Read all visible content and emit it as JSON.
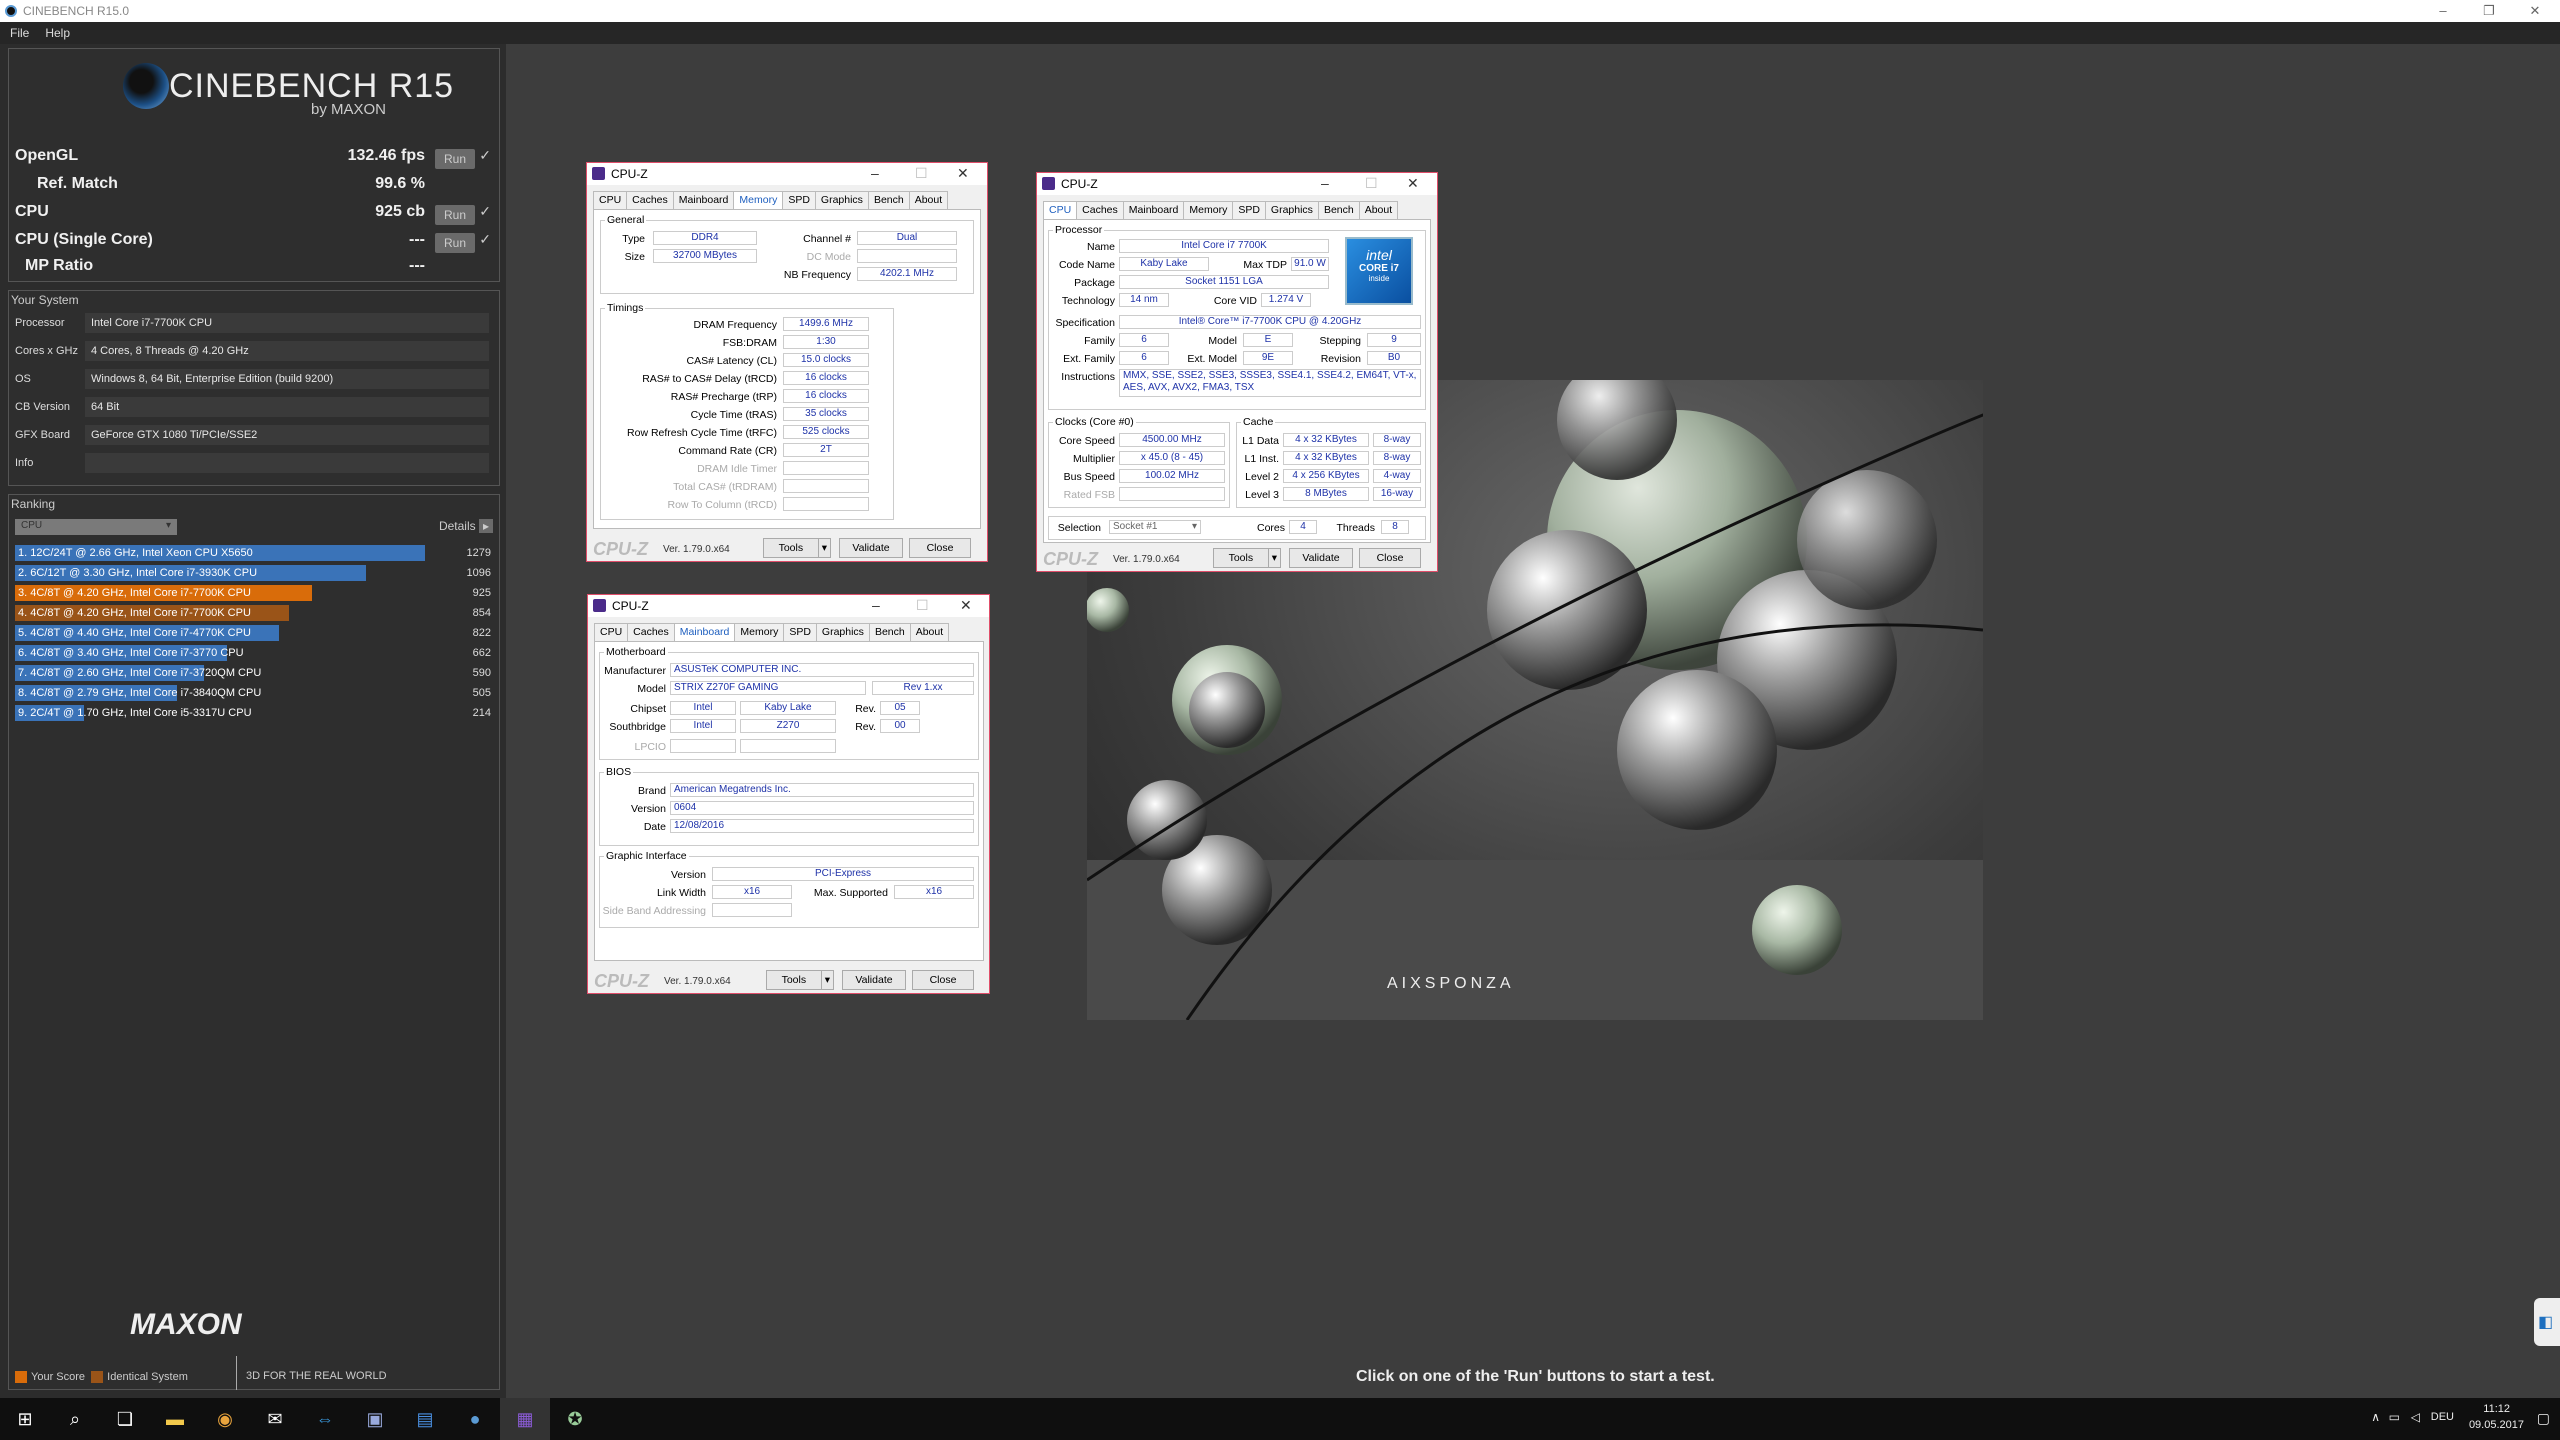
{
  "window": {
    "title": "CINEBENCH R15.0",
    "menu": [
      "File",
      "Help"
    ]
  },
  "logo": {
    "title": "CINEBENCH R15",
    "subtitle": "by MAXON"
  },
  "results": {
    "opengl": {
      "label": "OpenGL",
      "value": "132.46 fps",
      "run": "Run"
    },
    "refmatch": {
      "label": "Ref. Match",
      "value": "99.6 %"
    },
    "cpu": {
      "label": "CPU",
      "value": "925 cb",
      "run": "Run"
    },
    "cpu_single": {
      "label": "CPU (Single Core)",
      "value": "---",
      "run": "Run"
    },
    "mp_ratio": {
      "label": "MP Ratio",
      "value": "---"
    }
  },
  "system": {
    "title": "Your System",
    "rows": [
      {
        "k": "Processor",
        "v": "Intel Core i7-7700K CPU"
      },
      {
        "k": "Cores x GHz",
        "v": "4 Cores, 8 Threads @ 4.20 GHz"
      },
      {
        "k": "OS",
        "v": "Windows 8, 64 Bit, Enterprise Edition (build 9200)"
      },
      {
        "k": "CB Version",
        "v": "64 Bit"
      },
      {
        "k": "GFX Board",
        "v": "GeForce GTX 1080 Ti/PCIe/SSE2"
      },
      {
        "k": "Info",
        "v": ""
      }
    ]
  },
  "ranking": {
    "title": "Ranking",
    "dropdown": "CPU",
    "details": "Details",
    "max": 1279,
    "rows": [
      {
        "label": "1. 12C/24T @ 2.66 GHz, Intel Xeon CPU X5650",
        "score": 1279,
        "color": "#3a73b8"
      },
      {
        "label": "2. 6C/12T @ 3.30 GHz,  Intel Core i7-3930K CPU",
        "score": 1096,
        "color": "#3a73b8"
      },
      {
        "label": "3. 4C/8T @ 4.20 GHz, Intel Core i7-7700K CPU",
        "score": 925,
        "color": "#d96c0a"
      },
      {
        "label": "4. 4C/8T @ 4.20 GHz, Intel Core i7-7700K CPU",
        "score": 854,
        "color": "#9a5418"
      },
      {
        "label": "5. 4C/8T @ 4.40 GHz, Intel Core i7-4770K CPU",
        "score": 822,
        "color": "#3a73b8"
      },
      {
        "label": "6. 4C/8T @ 3.40 GHz,  Intel Core i7-3770 CPU",
        "score": 662,
        "color": "#3a73b8"
      },
      {
        "label": "7. 4C/8T @ 2.60 GHz, Intel Core i7-3720QM CPU",
        "score": 590,
        "color": "#3a73b8"
      },
      {
        "label": "8. 4C/8T @ 2.79 GHz,  Intel Core i7-3840QM CPU",
        "score": 505,
        "color": "#3a73b8"
      },
      {
        "label": "9. 2C/4T @ 1.70 GHz,  Intel Core i5-3317U CPU",
        "score": 214,
        "color": "#3a73b8"
      }
    ],
    "legend_your": "Your Score",
    "legend_identical": "Identical System"
  },
  "footer": {
    "brand": "MAXON",
    "tagline": "3D FOR THE REAL WORLD",
    "status": "Click on one of the 'Run' buttons to start a test."
  },
  "render": {
    "watermark": "AIXSPONZA"
  },
  "cpuz_common": {
    "title": "CPU-Z",
    "tabs": [
      "CPU",
      "Caches",
      "Mainboard",
      "Memory",
      "SPD",
      "Graphics",
      "Bench",
      "About"
    ],
    "brand": "CPU-Z",
    "version": "Ver. 1.79.0.x64",
    "tools": "Tools",
    "validate": "Validate",
    "close": "Close"
  },
  "memory": {
    "general": "General",
    "type_l": "Type",
    "type": "DDR4",
    "size_l": "Size",
    "size": "32700 MBytes",
    "channel_l": "Channel #",
    "channel": "Dual",
    "dcmode_l": "DC Mode",
    "nbfreq_l": "NB Frequency",
    "nbfreq": "4202.1 MHz",
    "timings": "Timings",
    "rows": [
      {
        "k": "DRAM Frequency",
        "v": "1499.6 MHz"
      },
      {
        "k": "FSB:DRAM",
        "v": "1:30"
      },
      {
        "k": "CAS# Latency (CL)",
        "v": "15.0 clocks"
      },
      {
        "k": "RAS# to CAS# Delay (tRCD)",
        "v": "16 clocks"
      },
      {
        "k": "RAS# Precharge (tRP)",
        "v": "16 clocks"
      },
      {
        "k": "Cycle Time (tRAS)",
        "v": "35 clocks"
      },
      {
        "k": "Row Refresh Cycle Time (tRFC)",
        "v": "525 clocks"
      },
      {
        "k": "Command Rate (CR)",
        "v": "2T"
      }
    ],
    "dim": [
      "DRAM Idle Timer",
      "Total CAS# (tRDRAM)",
      "Row To Column (tRCD)"
    ]
  },
  "mainboard": {
    "motherboard": "Motherboard",
    "manufacturer_l": "Manufacturer",
    "manufacturer": "ASUSTeK COMPUTER INC.",
    "model_l": "Model",
    "model": "STRIX Z270F GAMING",
    "model_rev": "Rev 1.xx",
    "chipset_l": "Chipset",
    "chipset_v": "Intel",
    "chipset_n": "Kaby Lake",
    "rev_l": "Rev.",
    "chipset_rev": "05",
    "south_l": "Southbridge",
    "south_v": "Intel",
    "south_n": "Z270",
    "south_rev": "00",
    "lpcio_l": "LPCIO",
    "bios": "BIOS",
    "brand_l": "Brand",
    "brand": "American Megatrends Inc.",
    "version_l": "Version",
    "version": "0604",
    "date_l": "Date",
    "date": "12/08/2016",
    "graphic": "Graphic Interface",
    "gversion_l": "Version",
    "gversion": "PCI-Express",
    "link_l": "Link Width",
    "link": "x16",
    "maxsup_l": "Max. Supported",
    "maxsup": "x16",
    "sideband_l": "Side Band Addressing"
  },
  "cpu": {
    "processor": "Processor",
    "name_l": "Name",
    "name": "Intel Core i7 7700K",
    "code_l": "Code Name",
    "code": "Kaby Lake",
    "tdp_l": "Max TDP",
    "tdp": "91.0 W",
    "pkg_l": "Package",
    "pkg": "Socket 1151 LGA",
    "tech_l": "Technology",
    "tech": "14 nm",
    "vid_l": "Core VID",
    "vid": "1.274 V",
    "spec_l": "Specification",
    "spec": "Intel® Core™ i7-7700K CPU @ 4.20GHz",
    "family_l": "Family",
    "family": "6",
    "model_l": "Model",
    "model": "E",
    "stepping_l": "Stepping",
    "stepping": "9",
    "extfam_l": "Ext. Family",
    "extfam": "6",
    "extmodel_l": "Ext. Model",
    "extmodel": "9E",
    "revision_l": "Revision",
    "revision": "B0",
    "instr_l": "Instructions",
    "instr": "MMX, SSE, SSE2, SSE3, SSSE3, SSE4.1, SSE4.2, EM64T, VT-x, AES, AVX, AVX2, FMA3, TSX",
    "clocks": "Clocks (Core #0)",
    "cspeed_l": "Core Speed",
    "cspeed": "4500.00 MHz",
    "mult_l": "Multiplier",
    "mult": "x 45.0 (8 - 45)",
    "bus_l": "Bus Speed",
    "bus": "100.02 MHz",
    "fsb_l": "Rated FSB",
    "cache": "Cache",
    "l1d_l": "L1 Data",
    "l1d": "4 x 32 KBytes",
    "l1d_w": "8-way",
    "l1i_l": "L1 Inst.",
    "l1i": "4 x 32 KBytes",
    "l1i_w": "8-way",
    "l2_l": "Level 2",
    "l2": "4 x 256 KBytes",
    "l2_w": "4-way",
    "l3_l": "Level 3",
    "l3": "8 MBytes",
    "l3_w": "16-way",
    "sel_l": "Selection",
    "sel": "Socket #1",
    "cores_l": "Cores",
    "cores": "4",
    "threads_l": "Threads",
    "threads": "8",
    "intel_brand": "intel",
    "intel_line": "CORE i7",
    "intel_inside": "inside"
  },
  "taskbar": {
    "lang": "DEU",
    "time": "11:12",
    "date": "09.05.2017"
  }
}
